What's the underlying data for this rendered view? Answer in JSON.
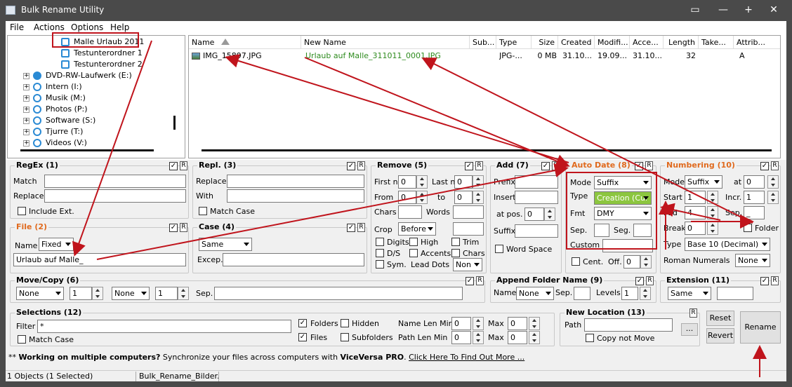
{
  "window": {
    "title": "Bulk Rename Utility"
  },
  "menu": [
    "File",
    "Actions",
    "Options",
    "Help"
  ],
  "tree": {
    "items": [
      {
        "label": "Malle Urlaub 2011",
        "selected": true
      },
      {
        "label": "Testunterordner 1"
      },
      {
        "label": "Testunterordner 2"
      },
      {
        "label": "DVD-RW-Laufwerk (E:)"
      },
      {
        "label": "Intern (I:)"
      },
      {
        "label": "Musik (M:)"
      },
      {
        "label": "Photos (P:)"
      },
      {
        "label": "Software (S:)"
      },
      {
        "label": "Tjurre (T:)"
      },
      {
        "label": "Videos (V:)"
      }
    ]
  },
  "filelist": {
    "columns": [
      "Name",
      "New Name",
      "Sub...",
      "Type",
      "Size",
      "Created",
      "Modifi...",
      "Acce...",
      "Length",
      "Take...",
      "Attrib..."
    ],
    "rows": [
      {
        "name": "IMG_15897.JPG",
        "new_name": "Urlaub auf Malle_311011_0001.JPG",
        "sub": "",
        "type": "JPG-...",
        "size": "0 MB",
        "created": "31.10...",
        "modified": "19.09...",
        "accessed": "31.10...",
        "length": "32",
        "taken": "",
        "attrib": "A"
      }
    ]
  },
  "regex": {
    "title": "RegEx (1)",
    "match_label": "Match",
    "replace_label": "Replace",
    "include_ext": "Include Ext.",
    "match": "",
    "replace": ""
  },
  "repl": {
    "title": "Repl. (3)",
    "replace_label": "Replace",
    "with_label": "With",
    "match_case": "Match Case"
  },
  "remove": {
    "title": "Remove (5)",
    "first_n": "First n",
    "first_n_val": "0",
    "last_n": "Last n",
    "last_n_val": "0",
    "from": "From",
    "from_val": "0",
    "to": "to",
    "to_val": "0",
    "chars": "Chars",
    "words": "Words",
    "crop": "Crop",
    "crop_val": "Before",
    "digits": "Digits",
    "high": "High",
    "trim": "Trim",
    "ds": "D/S",
    "accents": "Accents",
    "chars2": "Chars",
    "sym": "Sym.",
    "lead_dots": "Lead Dots",
    "lead_dots_val": "Non"
  },
  "add": {
    "title": "Add (7)",
    "prefix": "Prefix",
    "insert": "Insert",
    "at_pos": "at pos.",
    "at_pos_val": "0",
    "suffix": "Suffix",
    "word_space": "Word Space"
  },
  "autodate": {
    "title": "Auto Date (8)",
    "mode_label": "Mode",
    "mode": "Suffix",
    "type_label": "Type",
    "type": "Creation (Cur",
    "fmt_label": "Fmt",
    "fmt": "DMY",
    "sep_label": "Sep.",
    "seg_label": "Seg.",
    "custom_label": "Custom",
    "cent": "Cent.",
    "off_label": "Off.",
    "off_val": "0"
  },
  "numbering": {
    "title": "Numbering (10)",
    "mode_label": "Mode",
    "mode": "Suffix",
    "at_label": "at",
    "at_val": "0",
    "start_label": "Start",
    "start_val": "1",
    "incr_label": "Incr.",
    "incr_val": "1",
    "pad_label": "Pad",
    "pad_val": "4",
    "sep_label": "Sep.",
    "sep_val": "_",
    "break_label": "Break",
    "break_val": "0",
    "folder_label": "Folder",
    "type_label": "Type",
    "type_val": "Base 10 (Decimal)",
    "roman_label": "Roman Numerals",
    "roman_val": "None"
  },
  "file": {
    "title": "File (2)",
    "name_label": "Name",
    "name_mode": "Fixed",
    "name_value": "Urlaub auf Malle_"
  },
  "case": {
    "title": "Case (4)",
    "mode": "Same",
    "excep_label": "Excep."
  },
  "movecopy": {
    "title": "Move/Copy (6)",
    "sel1": "None",
    "num1": "1",
    "sel2": "None",
    "num2": "1",
    "sep_label": "Sep."
  },
  "appendfolder": {
    "title": "Append Folder Name (9)",
    "name_label": "Name",
    "name_val": "None",
    "sep_label": "Sep.",
    "levels_label": "Levels",
    "levels_val": "1"
  },
  "extension": {
    "title": "Extension (11)",
    "mode": "Same"
  },
  "selections": {
    "title": "Selections (12)",
    "filter_label": "Filter",
    "filter_val": "*",
    "folders": "Folders",
    "hidden": "Hidden",
    "files": "Files",
    "subfolders": "Subfolders",
    "match_case": "Match Case",
    "name_len_min": "Name Len Min",
    "name_len_min_val": "0",
    "path_len_min": "Path Len Min",
    "path_len_min_val": "0",
    "max1_label": "Max",
    "max1_val": "0",
    "max2_label": "Max",
    "max2_val": "0"
  },
  "newlocation": {
    "title": "New Location (13)",
    "path_label": "Path",
    "browse": "...",
    "copy_not_move": "Copy not Move"
  },
  "buttons": {
    "reset": "Reset",
    "revert": "Revert",
    "rename": "Rename"
  },
  "promo": {
    "prefix": "**",
    "bold": "Working on multiple computers?",
    "text": " Synchronize your files across computers with ",
    "product": "ViceVersa PRO",
    "dot": ". ",
    "link": "Click Here To Find Out More ..."
  },
  "status": {
    "objects": "1 Objects (1 Selected)",
    "file": "Bulk_Rename_Bilder.t"
  },
  "colors": {
    "titlebar": "#4a4a4a",
    "accent_orange": "#e06a1e",
    "annotation_red": "#c0141c",
    "new_name_green": "#2e8b1e",
    "type_highlight": "#8cc63f"
  }
}
